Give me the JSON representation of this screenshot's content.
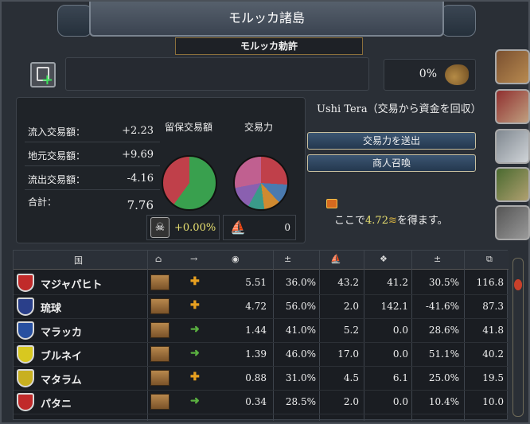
{
  "window": {
    "title": "モルッカ諸島",
    "subtitle": "モルッカ勅許"
  },
  "colors": {
    "accent_gold": "#e8e070",
    "positive_green": "#3be05a",
    "panel": "#2a2f36"
  },
  "top": {
    "percent": "0%",
    "percent_icon": "trade-goods-icon"
  },
  "stats": [
    {
      "label": "流入交易額：",
      "value": "+2.23"
    },
    {
      "label": "地元交易額：",
      "value": "+9.69"
    },
    {
      "label": "流出交易額：",
      "value": "-4.16"
    },
    {
      "label": "合計：",
      "value": "7.76"
    }
  ],
  "pies": {
    "retained_label": "留保交易額",
    "power_label": "交易力"
  },
  "bottom": {
    "pirate_value": "+0.00%",
    "ship_value": "0"
  },
  "merchant": {
    "label": "Ushi Tera（交易から資金を回収）",
    "send_power_button": "交易力を送出",
    "recall_button": "商人召喚",
    "gain_prefix": "ここで",
    "gain_value": "4.72",
    "gain_suffix": "を得ます。"
  },
  "table": {
    "headers": {
      "country": "国"
    },
    "rows": [
      {
        "name": "マジャパヒト",
        "c1": "5.51",
        "c2": "36.0%",
        "c3": "43.2",
        "c4": "41.2",
        "c5": "30.5%",
        "c6": "116.8",
        "shield_color": "#c02a2a",
        "arrow": "plus"
      },
      {
        "name": "琉球",
        "c1": "4.72",
        "c2": "56.0%",
        "c3": "2.0",
        "c4": "142.1",
        "c5": "-41.6%",
        "c6": "87.3",
        "shield_color": "#2a3f8a",
        "arrow": "plus"
      },
      {
        "name": "マラッカ",
        "c1": "1.44",
        "c2": "41.0%",
        "c3": "5.2",
        "c4": "0.0",
        "c5": "28.6%",
        "c6": "41.8",
        "shield_color": "#2850a0",
        "arrow": "right"
      },
      {
        "name": "ブルネイ",
        "c1": "1.39",
        "c2": "46.0%",
        "c3": "17.0",
        "c4": "0.0",
        "c5": "51.1%",
        "c6": "40.2",
        "shield_color": "#d8c820",
        "arrow": "right"
      },
      {
        "name": "マタラム",
        "c1": "0.88",
        "c2": "31.0%",
        "c3": "4.5",
        "c4": "6.1",
        "c5": "25.0%",
        "c6": "19.5",
        "shield_color": "#c8b020",
        "arrow": "plus"
      },
      {
        "name": "パタニ",
        "c1": "0.34",
        "c2": "28.5%",
        "c3": "2.0",
        "c4": "0.0",
        "c5": "10.4%",
        "c6": "10.0",
        "shield_color": "#c02a2a",
        "arrow": "right"
      }
    ]
  }
}
